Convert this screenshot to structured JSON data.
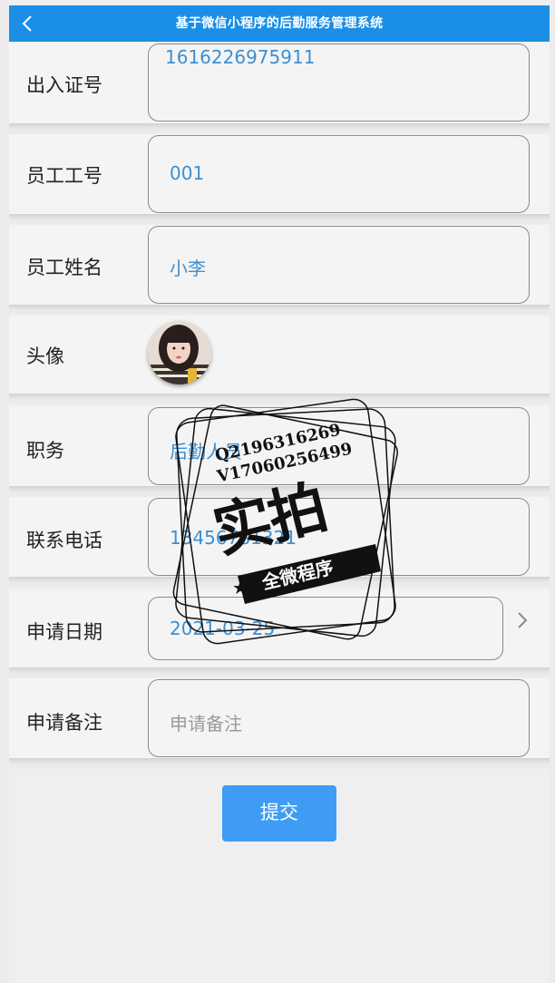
{
  "header": {
    "title": "基于微信小程序的后勤服务管理系统",
    "back_icon": "chevron-left-icon"
  },
  "form": {
    "pass_no": {
      "label": "出入证号",
      "value": "1616226975911"
    },
    "staff_no": {
      "label": "员工工号",
      "value": "001"
    },
    "staff_name": {
      "label": "员工姓名",
      "value": "小李"
    },
    "avatar": {
      "label": "头像"
    },
    "position": {
      "label": "职务",
      "value": "后勤人员"
    },
    "phone": {
      "label": "联系电话",
      "value": "13456781321"
    },
    "apply_date": {
      "label": "申请日期",
      "value": "2021-03-25",
      "icon": "chevron-right-icon"
    },
    "remark": {
      "label": "申请备注",
      "placeholder": "申请备注"
    }
  },
  "submit_label": "提交",
  "watermark": {
    "line1": "Q2196316269",
    "line2": "V17060256499",
    "big_text": "实拍",
    "band_text": "全微程序"
  },
  "colors": {
    "accent": "#1b8fe6",
    "button": "#3f9cf4",
    "value_text": "#3e8fd0"
  }
}
